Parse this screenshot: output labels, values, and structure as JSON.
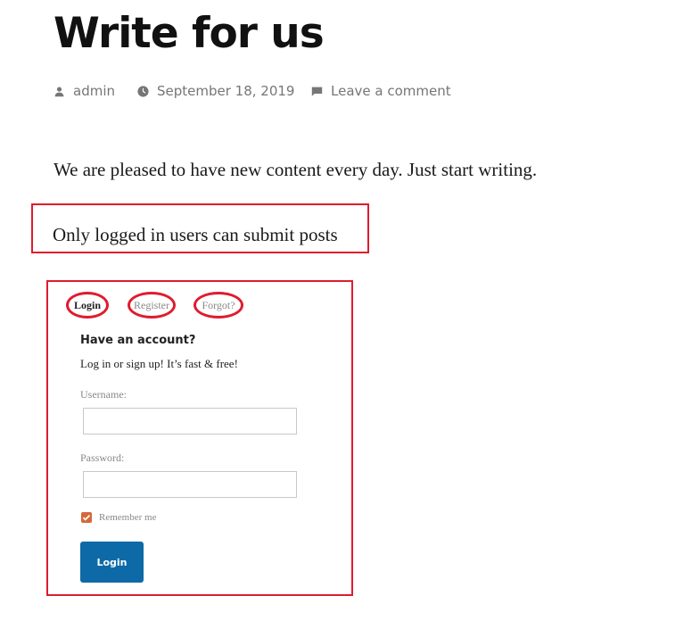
{
  "post": {
    "title": "Write for us",
    "author": "admin",
    "date": "September 18, 2019",
    "comment_link": "Leave a comment",
    "intro": "We are pleased to have new content every day. Just start writing.",
    "notice": "Only logged in users can submit posts"
  },
  "icons": {
    "author": "person-icon",
    "date": "clock-icon",
    "comment": "comment-bubble-icon",
    "checkbox": "checkmark-icon"
  },
  "login_box": {
    "tabs": [
      {
        "label": "Login",
        "active": true
      },
      {
        "label": "Register",
        "active": false
      },
      {
        "label": "Forgot?",
        "active": false
      }
    ],
    "heading": "Have an account?",
    "subheading": "Log in or sign up! It’s fast & free!",
    "username_label": "Username:",
    "username_value": "",
    "password_label": "Password:",
    "password_value": "",
    "remember_label": "Remember me",
    "remember_checked": true,
    "submit_label": "Login"
  },
  "colors": {
    "highlight": "#e01b2f",
    "button": "#0d6aa7",
    "checkbox": "#d4683a",
    "meta_text": "#767676"
  }
}
